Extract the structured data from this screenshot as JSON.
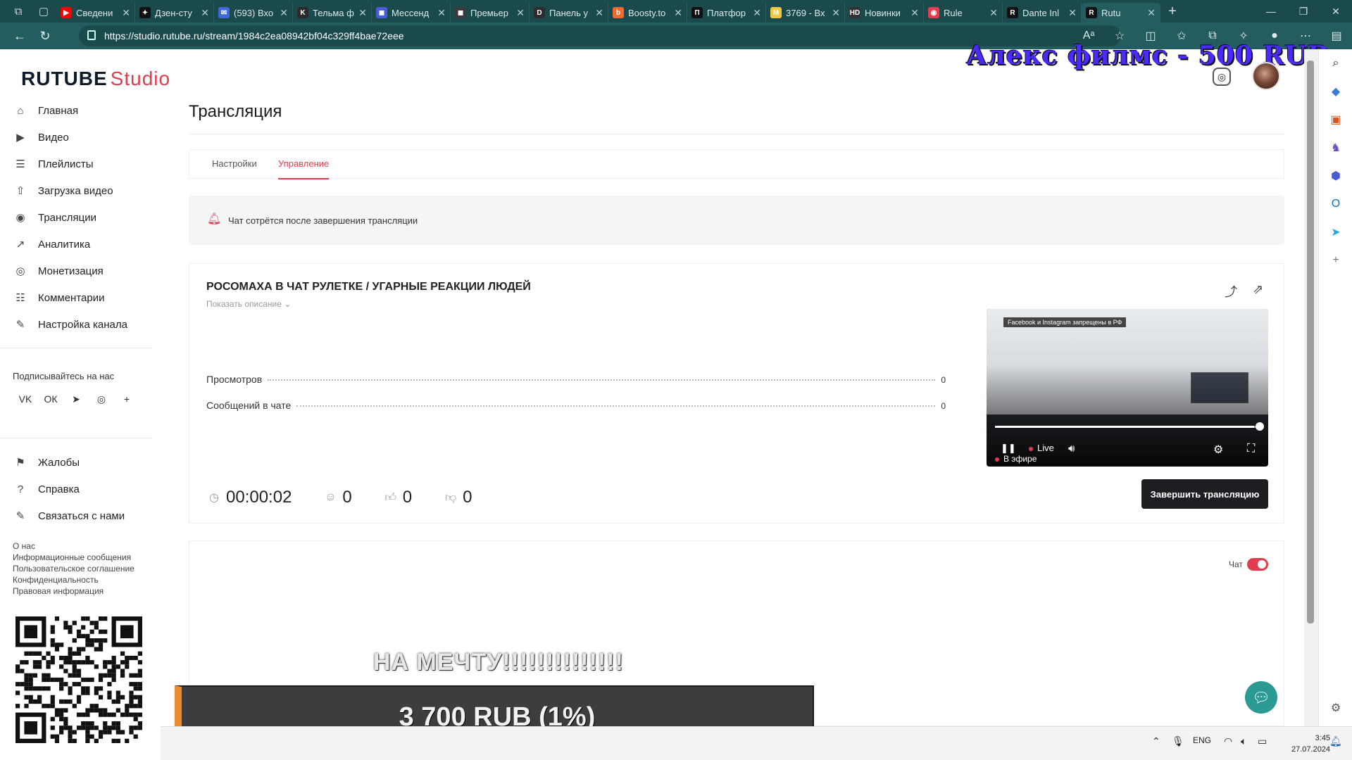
{
  "browser": {
    "tabs": [
      {
        "label": "Сведени",
        "fav_color": "#ff0000",
        "fav": "▶"
      },
      {
        "label": "Дзен-сту",
        "fav_color": "#111111",
        "fav": "✦"
      },
      {
        "label": "(593) Вхо",
        "fav_color": "#3d6ad6",
        "fav": "✉"
      },
      {
        "label": "Тельма ф",
        "fav_color": "#2b2b2b",
        "fav": "K"
      },
      {
        "label": "Мессенд",
        "fav_color": "#4a5bd6",
        "fav": "◼"
      },
      {
        "label": "Премьер",
        "fav_color": "#3a3a3a",
        "fav": "◼"
      },
      {
        "label": "Панель у",
        "fav_color": "#2d2d2d",
        "fav": "D"
      },
      {
        "label": "Boosty.to",
        "fav_color": "#f06a2f",
        "fav": "b"
      },
      {
        "label": "Платфор",
        "fav_color": "#111111",
        "fav": "П"
      },
      {
        "label": "3769 - Вх",
        "fav_color": "#f2c744",
        "fav": "M"
      },
      {
        "label": "Новинки",
        "fav_color": "#333333",
        "fav": "HD"
      },
      {
        "label": "Rule",
        "fav_color": "#e23c4d",
        "fav": "◉"
      },
      {
        "label": "Dante Inl",
        "fav_color": "#111111",
        "fav": "R"
      },
      {
        "label": "Rutu",
        "fav_color": "#111111",
        "fav": "R"
      }
    ],
    "url": "https://studio.rutube.ru/stream/1984c2ea08942bf04c329ff4bae72eee"
  },
  "brand": {
    "name": "RUTUBE",
    "suffix": "Studio",
    "accent": "#e23c4d"
  },
  "sidebar": {
    "items": [
      {
        "label": "Главная",
        "icon": "home-icon",
        "glyph": "⌂"
      },
      {
        "label": "Видео",
        "icon": "video-icon",
        "glyph": "▶"
      },
      {
        "label": "Плейлисты",
        "icon": "playlist-icon",
        "glyph": "☰"
      },
      {
        "label": "Загрузка видео",
        "icon": "upload-icon",
        "glyph": "⇧"
      },
      {
        "label": "Трансляции",
        "icon": "broadcast-icon",
        "glyph": "◉"
      },
      {
        "label": "Аналитика",
        "icon": "analytics-icon",
        "glyph": "↗"
      },
      {
        "label": "Монетизация",
        "icon": "monetization-icon",
        "glyph": "◎"
      },
      {
        "label": "Комментарии",
        "icon": "comments-icon",
        "glyph": "☷"
      },
      {
        "label": "Настройка канала",
        "icon": "wand-icon",
        "glyph": "✎"
      }
    ],
    "follow_label": "Подписывайтесь на нас",
    "socials": [
      "VK",
      "ОК",
      "➤",
      "◎",
      "+"
    ],
    "secondary": [
      {
        "label": "Жалобы",
        "icon": "flag-icon",
        "glyph": "⚑"
      },
      {
        "label": "Справка",
        "icon": "help-icon",
        "glyph": "?"
      },
      {
        "label": "Связаться с нами",
        "icon": "contact-icon",
        "glyph": "✎"
      }
    ],
    "footer": [
      "О нас",
      "Информационные сообщения",
      "Пользовательское соглашение",
      "Конфиденциальность",
      "Правовая информация"
    ]
  },
  "overlay": {
    "top_donation": "Алекс филмс - 500 RUB",
    "donation_message": "НА МЕЧТУ!!!!!!!!!!!!!!",
    "goal": "3 700 RUB (1%)"
  },
  "page": {
    "title": "Трансляция",
    "tabs": {
      "settings": "Настройки",
      "control": "Управление"
    },
    "notice": "Чат сотрётся после завершения трансляции",
    "stream": {
      "title": "РОСОМАХА В ЧАТ РУЛЕТКЕ / УГАРНЫЕ РЕАКЦИИ ЛЮДЕЙ",
      "show_description": "Показать описание ⌄",
      "views_label": "Просмотров",
      "views_value": "0",
      "chat_label": "Сообщений в чате",
      "chat_value": "0",
      "duration": "00:00:02",
      "viewers": "0",
      "likes": "0",
      "dislikes": "0",
      "end_button": "Завершить трансляцию"
    },
    "player": {
      "banner": "Facebook и Instagram запрещены в РФ",
      "live": "Live",
      "on_air": "В эфире",
      "progress": 0.98
    },
    "chat": {
      "label": "Чат",
      "enabled": true
    }
  },
  "taskbar": {
    "lang": "ENG",
    "time": "3:45",
    "date": "27.07.2024"
  }
}
